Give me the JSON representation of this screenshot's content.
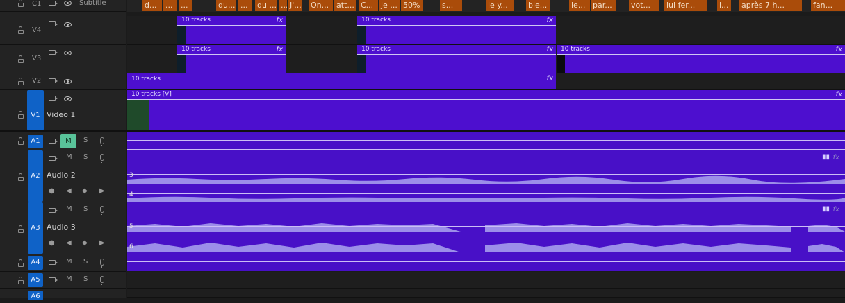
{
  "tracks": {
    "subtitle": {
      "badge": "C1",
      "name": "Subtitle"
    },
    "v4": {
      "badge": "V4"
    },
    "v3": {
      "badge": "V3"
    },
    "v2": {
      "badge": "V2"
    },
    "v1": {
      "badge": "V1",
      "name": "Video 1"
    },
    "a1": {
      "badge": "A1",
      "m": "M",
      "s": "S"
    },
    "a2": {
      "badge": "A2",
      "name": "Audio 2",
      "m": "M",
      "s": "S"
    },
    "a3": {
      "badge": "A3",
      "name": "Audio 3",
      "m": "M",
      "s": "S"
    },
    "a4": {
      "badge": "A4",
      "m": "M",
      "s": "S"
    },
    "a5": {
      "badge": "A5",
      "m": "M",
      "s": "S"
    },
    "a6": {
      "badge": "A6"
    }
  },
  "subtitles": [
    "d...",
    "...",
    "...",
    "du...",
    "...",
    "du ...",
    "...",
    "J'...",
    "On...",
    "att...",
    "C...",
    "je ...",
    "50%",
    "s...",
    "le y...",
    "bie...",
    "le...",
    "par...",
    "vot...",
    "lui fer...",
    "i...",
    "après 7 h...",
    "fan..."
  ],
  "clip_label": "10 tracks",
  "clip_label_v1": "10 tracks [V]",
  "fx_label": "fx",
  "channels": {
    "c3": "3",
    "c4": "4",
    "c5": "5",
    "c6": "6"
  },
  "colors": {
    "clip": "#4d0fcf",
    "subtitle": "#aa4c0a",
    "badge": "#0f62c7",
    "mute_on": "#59c39a"
  }
}
